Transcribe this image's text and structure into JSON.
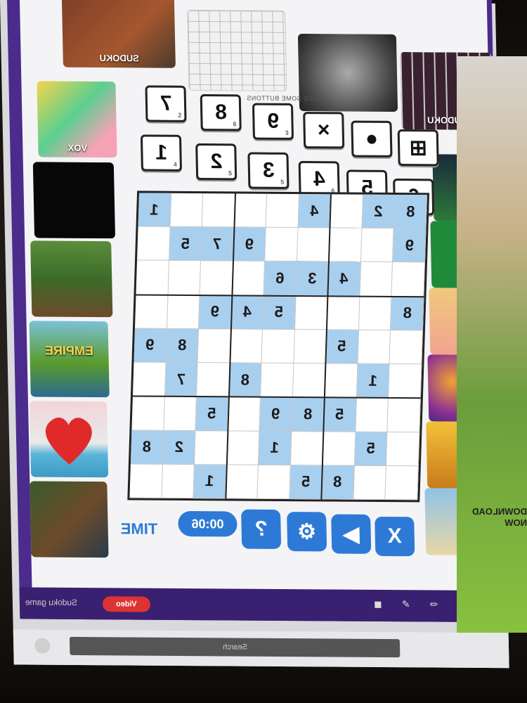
{
  "top_thumbnails": [
    {
      "name": "sudoku-thumb-1",
      "label": "SUDOKU"
    },
    {
      "name": "sudoku-grid-thumb",
      "label": ""
    },
    {
      "name": "dark-emblem-thumb",
      "label": ""
    },
    {
      "name": "sudoku-thumb-2",
      "label": "SUDOKU"
    }
  ],
  "left_thumbnails": [
    {
      "name": "voxel-thumb",
      "label": "VOX"
    },
    {
      "name": "neon-thumb",
      "label": ""
    },
    {
      "name": "minecraft-thumb",
      "label": ""
    },
    {
      "name": "empire-thumb",
      "label": "EMPIRE"
    },
    {
      "name": "heart-thumb",
      "label": ""
    },
    {
      "name": "adventure-thumb",
      "label": ""
    }
  ],
  "right_thumbnails": [
    {
      "name": "racing-thumb",
      "label": ""
    },
    {
      "name": "solitaire-thumb",
      "label": ""
    },
    {
      "name": "anime-thumb",
      "label": ""
    },
    {
      "name": "bubble-thumb",
      "label": ""
    },
    {
      "name": "owl-thumb",
      "label": ""
    },
    {
      "name": "spongebob-thumb",
      "label": ""
    }
  ],
  "number_buttons_top": [
    {
      "value": "7",
      "count": "2"
    },
    {
      "value": "8",
      "count": "6"
    },
    {
      "value": "9",
      "count": "3"
    },
    {
      "value": "×",
      "count": ""
    },
    {
      "value": "●",
      "count": ""
    },
    {
      "value": "⊞",
      "count": ""
    }
  ],
  "number_buttons_bottom": [
    {
      "value": "1",
      "count": "4"
    },
    {
      "value": "2",
      "count": "5"
    },
    {
      "value": "3",
      "count": "5"
    },
    {
      "value": "4",
      "count": "6"
    },
    {
      "value": "5",
      "count": "8"
    },
    {
      "value": "6",
      "count": "4"
    }
  ],
  "hint_label": "NEED SOME BUTTONS",
  "board": {
    "rows": [
      [
        "1",
        "",
        "",
        "",
        "",
        "4",
        "",
        "2",
        "8"
      ],
      [
        "",
        "5",
        "7",
        "9",
        "",
        "",
        "",
        "",
        "9"
      ],
      [
        "",
        "",
        "",
        "",
        "6",
        "3",
        "4",
        "",
        ""
      ],
      [
        "",
        "",
        "9",
        "4",
        "5",
        "",
        "",
        "",
        "8"
      ],
      [
        "9",
        "8",
        "",
        "",
        "",
        "",
        "5",
        "",
        ""
      ],
      [
        "",
        "7",
        "",
        "8",
        "",
        "",
        "",
        "1",
        ""
      ],
      [
        "",
        "",
        "5",
        "",
        "9",
        "8",
        "5",
        "",
        ""
      ],
      [
        "8",
        "2",
        "",
        "",
        "1",
        "",
        "",
        "5",
        ""
      ],
      [
        "",
        "",
        "1",
        "",
        "",
        "5",
        "8",
        "",
        ""
      ]
    ],
    "given": [
      [
        1,
        0,
        0,
        0,
        0,
        1,
        0,
        1,
        1
      ],
      [
        0,
        1,
        1,
        1,
        0,
        0,
        0,
        0,
        1
      ],
      [
        0,
        0,
        0,
        0,
        1,
        1,
        1,
        0,
        0
      ],
      [
        0,
        0,
        1,
        1,
        1,
        0,
        0,
        0,
        1
      ],
      [
        1,
        1,
        0,
        0,
        0,
        0,
        1,
        0,
        0
      ],
      [
        0,
        1,
        0,
        1,
        0,
        0,
        0,
        1,
        0
      ],
      [
        0,
        0,
        1,
        0,
        1,
        1,
        1,
        0,
        0
      ],
      [
        1,
        1,
        0,
        0,
        1,
        0,
        0,
        1,
        0
      ],
      [
        0,
        0,
        1,
        0,
        0,
        1,
        1,
        0,
        0
      ]
    ]
  },
  "controls": {
    "time_label": "TIME",
    "timer_value": "00:06",
    "hint_icon": "?",
    "settings_icon": "⚙",
    "sound_icon": "◀",
    "close_icon": "X"
  },
  "bottom_bar": {
    "text": "Sudoku game",
    "badge": "Video",
    "icons": [
      "◼",
      "✎",
      "✏",
      "✈"
    ]
  },
  "os_bar": {
    "search": "Search"
  },
  "ad": {
    "text": "DOWNLOAD NOW"
  }
}
